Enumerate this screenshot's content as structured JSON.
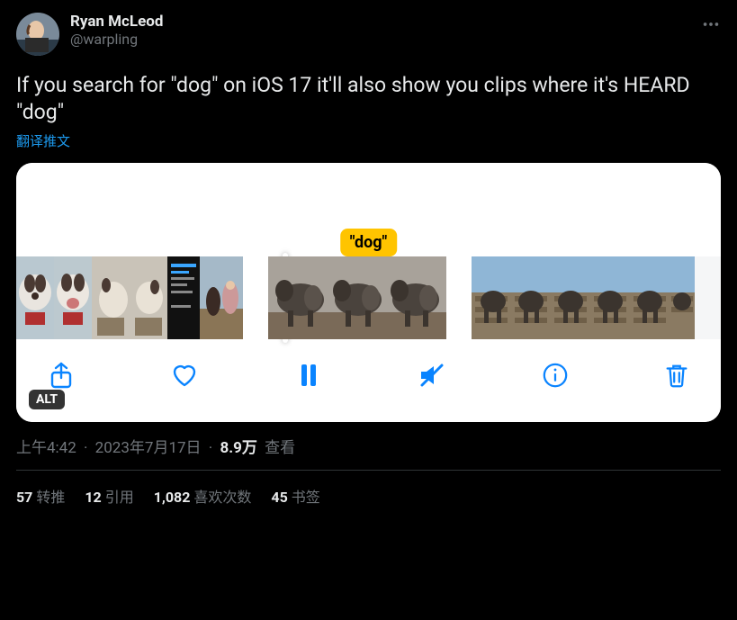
{
  "user": {
    "display_name": "Ryan McLeod",
    "handle": "@warpling"
  },
  "body": "If you search for \"dog\" on iOS 17 it'll also show you clips where it's HEARD \"dog\"",
  "translate": "翻译推文",
  "media": {
    "alt_badge": "ALT",
    "tag_label": "\"dog\""
  },
  "meta": {
    "time": "上午4:42",
    "date": "2023年7月17日",
    "views_count": "8.9万",
    "views_label": "查看"
  },
  "stats": {
    "retweets_n": "57",
    "retweets_l": "转推",
    "quotes_n": "12",
    "quotes_l": "引用",
    "likes_n": "1,082",
    "likes_l": "喜欢次数",
    "bookmarks_n": "45",
    "bookmarks_l": "书签"
  }
}
